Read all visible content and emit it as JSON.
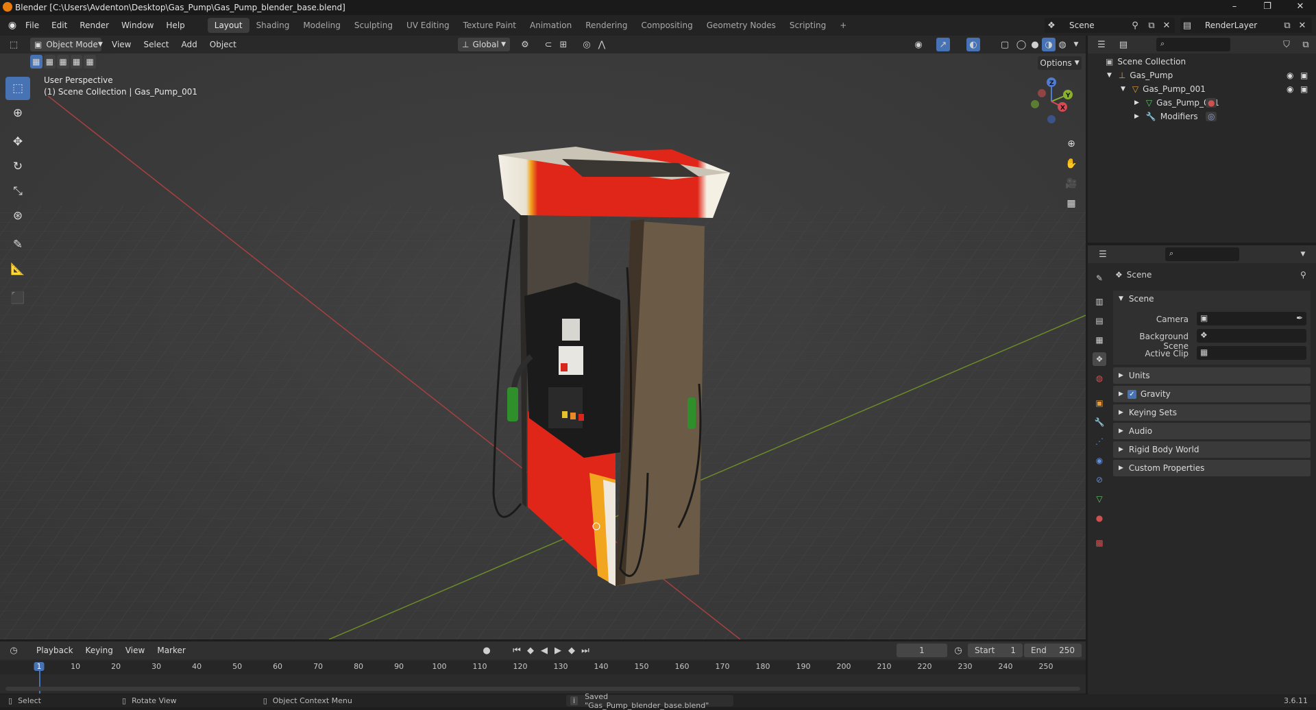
{
  "window": {
    "title": "Blender [C:\\Users\\Avdenton\\Desktop\\Gas_Pump\\Gas_Pump_blender_base.blend]",
    "minimize": "–",
    "maximize": "❐",
    "close": "✕"
  },
  "menubar": {
    "menus": [
      "File",
      "Edit",
      "Render",
      "Window",
      "Help"
    ],
    "workspaces": [
      "Layout",
      "Shading",
      "Modeling",
      "Sculpting",
      "UV Editing",
      "Texture Paint",
      "Animation",
      "Rendering",
      "Compositing",
      "Geometry Nodes",
      "Scripting"
    ],
    "add_workspace": "+",
    "scene": "Scene",
    "view_layer": "RenderLayer"
  },
  "viewport": {
    "mode": "Object Mode",
    "menus": [
      "View",
      "Select",
      "Add",
      "Object"
    ],
    "transform_orientation": "Global",
    "options": "Options",
    "overlay_line1": "User Perspective",
    "overlay_line2": "(1) Scene Collection | Gas_Pump_001",
    "gizmo_axes": [
      "Z",
      "Y",
      "X"
    ]
  },
  "outliner": {
    "root": "Scene Collection",
    "rows": [
      {
        "label": "Gas_Pump",
        "depth": 1
      },
      {
        "label": "Gas_Pump_001",
        "depth": 2
      },
      {
        "label": "Gas_Pump_001",
        "depth": 3
      },
      {
        "label": "Modifiers",
        "depth": 3
      }
    ]
  },
  "properties": {
    "context": "Scene",
    "section": "Scene",
    "fields": [
      {
        "label": "Camera",
        "value": ""
      },
      {
        "label": "Background Scene",
        "value": ""
      },
      {
        "label": "Active Clip",
        "value": ""
      }
    ],
    "panels": [
      "Units",
      "Gravity",
      "Keying Sets",
      "Audio",
      "Rigid Body World",
      "Custom Properties"
    ],
    "gravity_enabled": true
  },
  "timeline": {
    "menus": [
      "Playback",
      "Keying",
      "View",
      "Marker"
    ],
    "current_frame": "1",
    "start_label": "Start",
    "start": "1",
    "end_label": "End",
    "end": "250",
    "ticks": [
      "1",
      "10",
      "20",
      "30",
      "40",
      "50",
      "60",
      "70",
      "80",
      "90",
      "100",
      "110",
      "120",
      "130",
      "140",
      "150",
      "160",
      "170",
      "180",
      "190",
      "200",
      "210",
      "220",
      "230",
      "240",
      "250"
    ]
  },
  "statusbar": {
    "select": "Select",
    "rotate": "Rotate View",
    "context_menu": "Object Context Menu",
    "message": "Saved \"Gas_Pump_blender_base.blend\"",
    "version": "3.6.11"
  },
  "colors": {
    "accent": "#4772b3",
    "pump_red": "#e02619",
    "pump_orange": "#f2a51e",
    "axis_x": "#b84a4a",
    "axis_y": "#7a9e2e"
  }
}
